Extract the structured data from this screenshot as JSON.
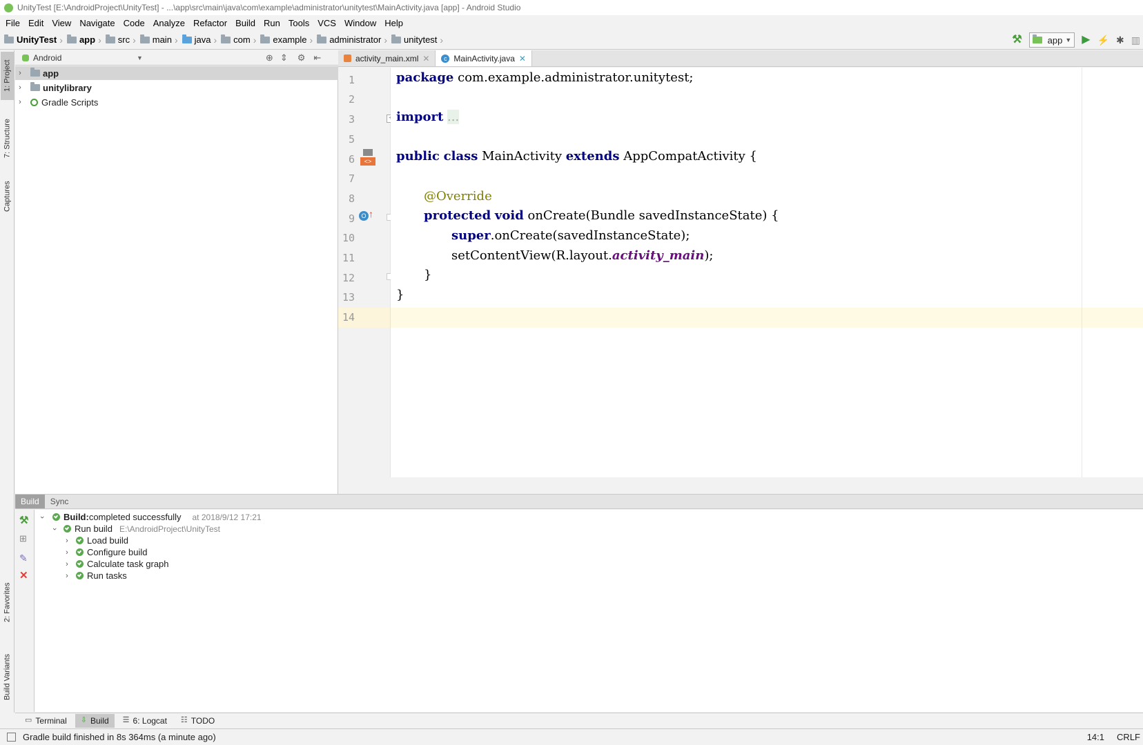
{
  "window": {
    "title": "UnityTest [E:\\AndroidProject\\UnityTest] - ...\\app\\src\\main\\java\\com\\example\\administrator\\unitytest\\MainActivity.java [app] - Android Studio"
  },
  "menu": [
    "File",
    "Edit",
    "View",
    "Navigate",
    "Code",
    "Analyze",
    "Refactor",
    "Build",
    "Run",
    "Tools",
    "VCS",
    "Window",
    "Help"
  ],
  "breadcrumbs": [
    "UnityTest",
    "app",
    "src",
    "main",
    "java",
    "com",
    "example",
    "administrator",
    "unitytest"
  ],
  "run_config": "app",
  "left_tools": [
    "1: Project",
    "7: Structure",
    "Captures",
    "2: Favorites",
    "Build Variants"
  ],
  "project": {
    "view_mode": "Android",
    "items": [
      {
        "label": "app",
        "bold": true
      },
      {
        "label": "unitylibrary",
        "bold": true
      },
      {
        "label": "Gradle Scripts",
        "bold": false
      }
    ]
  },
  "editor": {
    "tabs": [
      {
        "label": "activity_main.xml",
        "active": false
      },
      {
        "label": "MainActivity.java",
        "active": true
      }
    ],
    "line_numbers": [
      "1",
      "2",
      "3",
      "5",
      "6",
      "7",
      "8",
      "9",
      "10",
      "11",
      "12",
      "13",
      "14"
    ],
    "code": {
      "l1_kw": "package",
      "l1_rest": " com.example.administrator.unitytest;",
      "l3_kw": "import",
      "l3_fold": "...",
      "l6_kw1": "public",
      "l6_kw2": "class",
      "l6_name": " MainActivity ",
      "l6_kw3": "extends",
      "l6_rest": " AppCompatActivity {",
      "l8_ann": "@Override",
      "l9_kw1": "protected",
      "l9_kw2": "void",
      "l9_rest": " onCreate(Bundle savedInstanceState) {",
      "l10_kw": "super",
      "l10_rest": ".onCreate(savedInstanceState);",
      "l11_pre": "setContentView(R.layout.",
      "l11_field": "activity_main",
      "l11_post": ");",
      "l12": "}",
      "l13": "}"
    }
  },
  "build": {
    "tabs": [
      "Build",
      "Sync"
    ],
    "root_label_bold": "Build:",
    "root_label_rest": " completed successfully",
    "root_time": "at 2018/9/12 17:21",
    "run_build": "Run build",
    "run_build_path": "E:\\AndroidProject\\UnityTest",
    "tasks": [
      "Load build",
      "Configure build",
      "Calculate task graph",
      "Run tasks"
    ]
  },
  "bottom_tabs": [
    {
      "label": "Terminal",
      "active": false
    },
    {
      "label": "Build",
      "active": true
    },
    {
      "label": "6: Logcat",
      "active": false
    },
    {
      "label": "TODO",
      "active": false
    }
  ],
  "status": {
    "message": "Gradle build finished in 8s 364ms (a minute ago)",
    "position": "14:1",
    "line_sep": "CRLF"
  },
  "colors": {
    "keyword": "#000080",
    "annotation": "#808000",
    "field": "#660e7a",
    "success": "#5ca850",
    "current_line": "#fffae3"
  }
}
